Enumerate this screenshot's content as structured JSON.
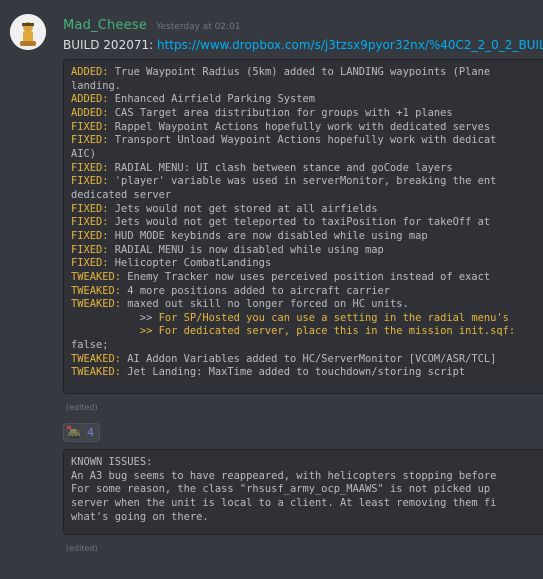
{
  "message": {
    "author": "Mad_Cheese",
    "timestamp": "Yesterday at 02:01",
    "build_label": "BUILD 202071:",
    "build_url": "https://www.dropbox.com/s/j3tzsx9pyor32nx/%40C2_2_0_2_BUIL"
  },
  "changelog": {
    "lines": [
      [
        {
          "t": "ADDED:",
          "c": "added"
        },
        {
          "t": " True Waypoint Radius (5km) added to LANDING waypoints (Plane"
        }
      ],
      [
        {
          "t": "landing."
        }
      ],
      [
        {
          "t": "ADDED:",
          "c": "added"
        },
        {
          "t": " Enhanced Airfield Parking System"
        }
      ],
      [
        {
          "t": "ADDED:",
          "c": "added"
        },
        {
          "t": " CAS Target area distribution for groups with +1 planes"
        }
      ],
      [
        {
          "t": "FIXED:",
          "c": "fixed"
        },
        {
          "t": " Rappel Waypoint Actions hopefully work with dedicated serves"
        }
      ],
      [
        {
          "t": "FIXED:",
          "c": "fixed"
        },
        {
          "t": " Transport Unload Waypoint Actions hopefully work with dedicat"
        }
      ],
      [
        {
          "t": "AIC)"
        }
      ],
      [
        {
          "t": "FIXED:",
          "c": "fixed"
        },
        {
          "t": " RADIAL MENU: UI clash between stance and goCode layers"
        }
      ],
      [
        {
          "t": "FIXED:",
          "c": "fixed"
        },
        {
          "t": " 'player' variable was used in serverMonitor, breaking the ent"
        }
      ],
      [
        {
          "t": "dedicated server"
        }
      ],
      [
        {
          "t": "FIXED:",
          "c": "fixed"
        },
        {
          "t": " Jets would not get stored at all airfields"
        }
      ],
      [
        {
          "t": "FIXED:",
          "c": "fixed"
        },
        {
          "t": " Jets would not get teleported to taxiPosition for takeOff at"
        }
      ],
      [
        {
          "t": "FIXED:",
          "c": "fixed"
        },
        {
          "t": " HUD MODE keybinds are now disabled while using map"
        }
      ],
      [
        {
          "t": "FIXED:",
          "c": "fixed"
        },
        {
          "t": " RADIAL MENU is now disabled while using map"
        }
      ],
      [
        {
          "t": "FIXED:",
          "c": "fixed"
        },
        {
          "t": " Helicopter CombatLandings"
        }
      ],
      [
        {
          "t": "TWEAKED:",
          "c": "tweaked"
        },
        {
          "t": " Enemy Tracker now uses perceived position instead of exact"
        }
      ],
      [
        {
          "t": "TWEAKED:",
          "c": "tweaked"
        },
        {
          "t": " 4 more positions added to aircraft carrier"
        }
      ],
      [
        {
          "t": "TWEAKED:",
          "c": "tweaked"
        },
        {
          "t": " maxed out skill no longer forced on HC units."
        }
      ],
      [
        {
          "t": "           >> "
        },
        {
          "t": "For SP/Hosted you can use a setting in the radial menu's",
          "c": "orange"
        }
      ],
      [
        {
          "t": "           >> For dedicated server, place this in the mission init.sqf:",
          "c": "orange"
        }
      ],
      [
        {
          "t": "false;"
        }
      ],
      [
        {
          "t": "TWEAKED:",
          "c": "tweaked"
        },
        {
          "t": " AI Addon Variables added to HC/ServerMonitor [VCOM/ASR/TCL]"
        }
      ],
      [
        {
          "t": "TWEAKED:",
          "c": "tweaked"
        },
        {
          "t": " Jet Landing: MaxTime added to touchdown/storing script"
        }
      ]
    ]
  },
  "edited_label_1": "(edited)",
  "reaction": {
    "icon": "tank-emoji-icon",
    "count": "4"
  },
  "known_issues": {
    "lines": [
      "KNOWN ISSUES:",
      "An A3 bug seems to have reappeared, with helicopters stopping before",
      "For some reason, the class \"rhsusf_army_ocp_MAAWS\" is not picked up",
      "server when the unit is local to a client. At least removing them fi",
      "what's going on there."
    ]
  },
  "edited_label_2": "(edited)"
}
